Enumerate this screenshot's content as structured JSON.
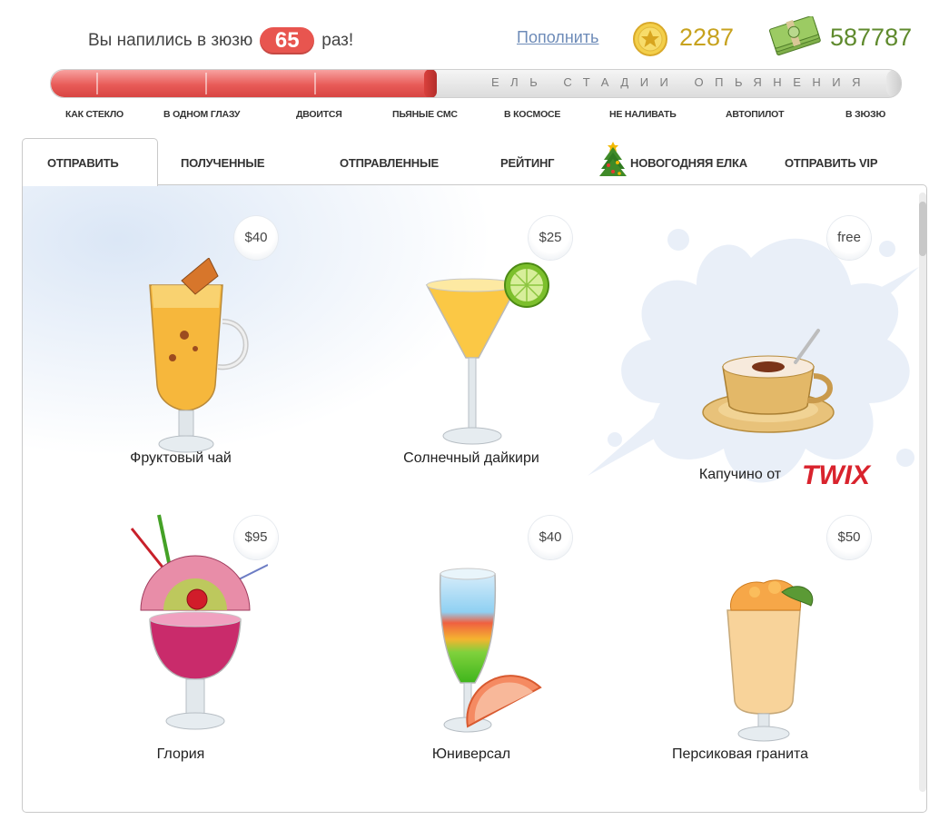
{
  "header": {
    "drunk_prefix": "Вы напились в зюзю",
    "drunk_count": "65",
    "drunk_suffix": "раз!",
    "topup_link": "Пополнить",
    "coins": "2287",
    "money": "587787"
  },
  "meter": {
    "label": "ЕЛЬ СТАДИИ ОПЬЯНЕНИЯ",
    "fill_fraction": 0.45,
    "stages": [
      "КАК СТЕКЛО",
      "В ОДНОМ ГЛАЗУ",
      "ДВОИТСЯ",
      "ПЬЯНЫЕ СМС",
      "В КОСМОСЕ",
      "НЕ НАЛИВАТЬ",
      "АВТОПИЛОТ",
      "В ЗЮЗЮ"
    ]
  },
  "tabs": [
    {
      "label": "ОТПРАВИТЬ",
      "active": true
    },
    {
      "label": "ПОЛУЧЕННЫЕ",
      "active": false
    },
    {
      "label": "ОТПРАВЛЕННЫЕ",
      "active": false
    },
    {
      "label": "РЕЙТИНГ",
      "active": false
    },
    {
      "label": "НОВОГОДНЯЯ ЕЛКА",
      "active": false
    },
    {
      "label": "ОТПРАВИТЬ VIP",
      "active": false
    }
  ],
  "drinks": [
    {
      "name": "Фруктовый чай",
      "price": "$40"
    },
    {
      "name": "Солнечный дайкири",
      "price": "$25"
    },
    {
      "name": "Капучино от",
      "price": "free",
      "brand": "TWIX"
    },
    {
      "name": "Глория",
      "price": "$95"
    },
    {
      "name": "Юниверсал",
      "price": "$40"
    },
    {
      "name": "Персиковая гранита",
      "price": "$50"
    }
  ],
  "colors": {
    "meter_fill": "#e85b58",
    "badge": "#e8554f",
    "coins_text": "#c7a21e",
    "money_text": "#5f8a2d",
    "link": "#6d8bb8"
  }
}
